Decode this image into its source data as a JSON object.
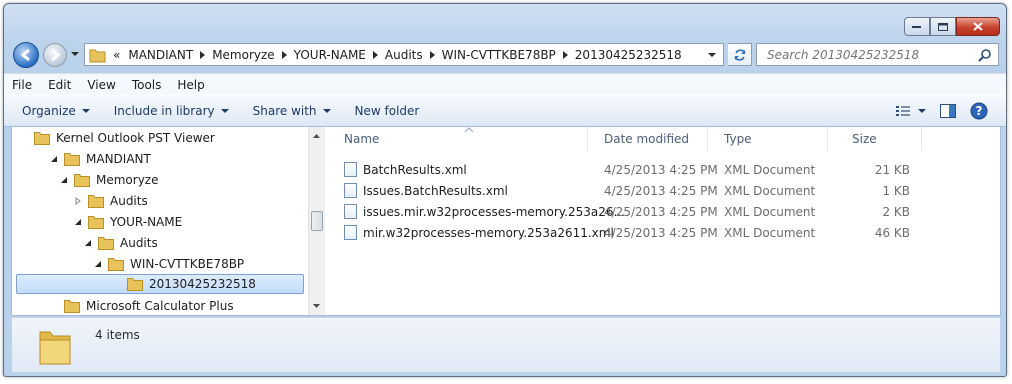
{
  "window": {
    "buttons": {
      "minimize": "minimize",
      "maximize": "maximize",
      "close": "close"
    }
  },
  "address": {
    "crumbs": [
      "MANDIANT",
      "Memoryze",
      "YOUR-NAME",
      "Audits",
      "WIN-CVTTKBE78BP",
      "20130425232518"
    ],
    "overflow": "«"
  },
  "search": {
    "placeholder": "Search 20130425232518"
  },
  "menu": {
    "items": [
      "File",
      "Edit",
      "View",
      "Tools",
      "Help"
    ]
  },
  "toolbar": {
    "organize": "Organize",
    "include": "Include in library",
    "share": "Share with",
    "newfolder": "New folder"
  },
  "tree": {
    "items": [
      {
        "label": "Kernel Outlook PST Viewer"
      },
      {
        "label": "MANDIANT"
      },
      {
        "label": "Memoryze"
      },
      {
        "label": "Audits"
      },
      {
        "label": "YOUR-NAME"
      },
      {
        "label": "Audits"
      },
      {
        "label": "WIN-CVTTKBE78BP"
      },
      {
        "label": "20130425232518"
      },
      {
        "label": "Microsoft Calculator Plus"
      }
    ]
  },
  "columns": {
    "name": "Name",
    "date": "Date modified",
    "type": "Type",
    "size": "Size"
  },
  "files": [
    {
      "name": "BatchResults.xml",
      "date": "4/25/2013 4:25 PM",
      "type": "XML Document",
      "size": "21 KB"
    },
    {
      "name": "Issues.BatchResults.xml",
      "date": "4/25/2013 4:25 PM",
      "type": "XML Document",
      "size": "1 KB"
    },
    {
      "name": "issues.mir.w32processes-memory.253a26...",
      "date": "4/25/2013 4:25 PM",
      "type": "XML Document",
      "size": "2 KB"
    },
    {
      "name": "mir.w32processes-memory.253a2611.xml",
      "date": "4/25/2013 4:25 PM",
      "type": "XML Document",
      "size": "46 KB"
    }
  ],
  "status": {
    "count": "4 items"
  },
  "colors": {
    "accent": "#1e3c64",
    "selection": "#c2dcfd",
    "folder": "#e8c25a"
  }
}
